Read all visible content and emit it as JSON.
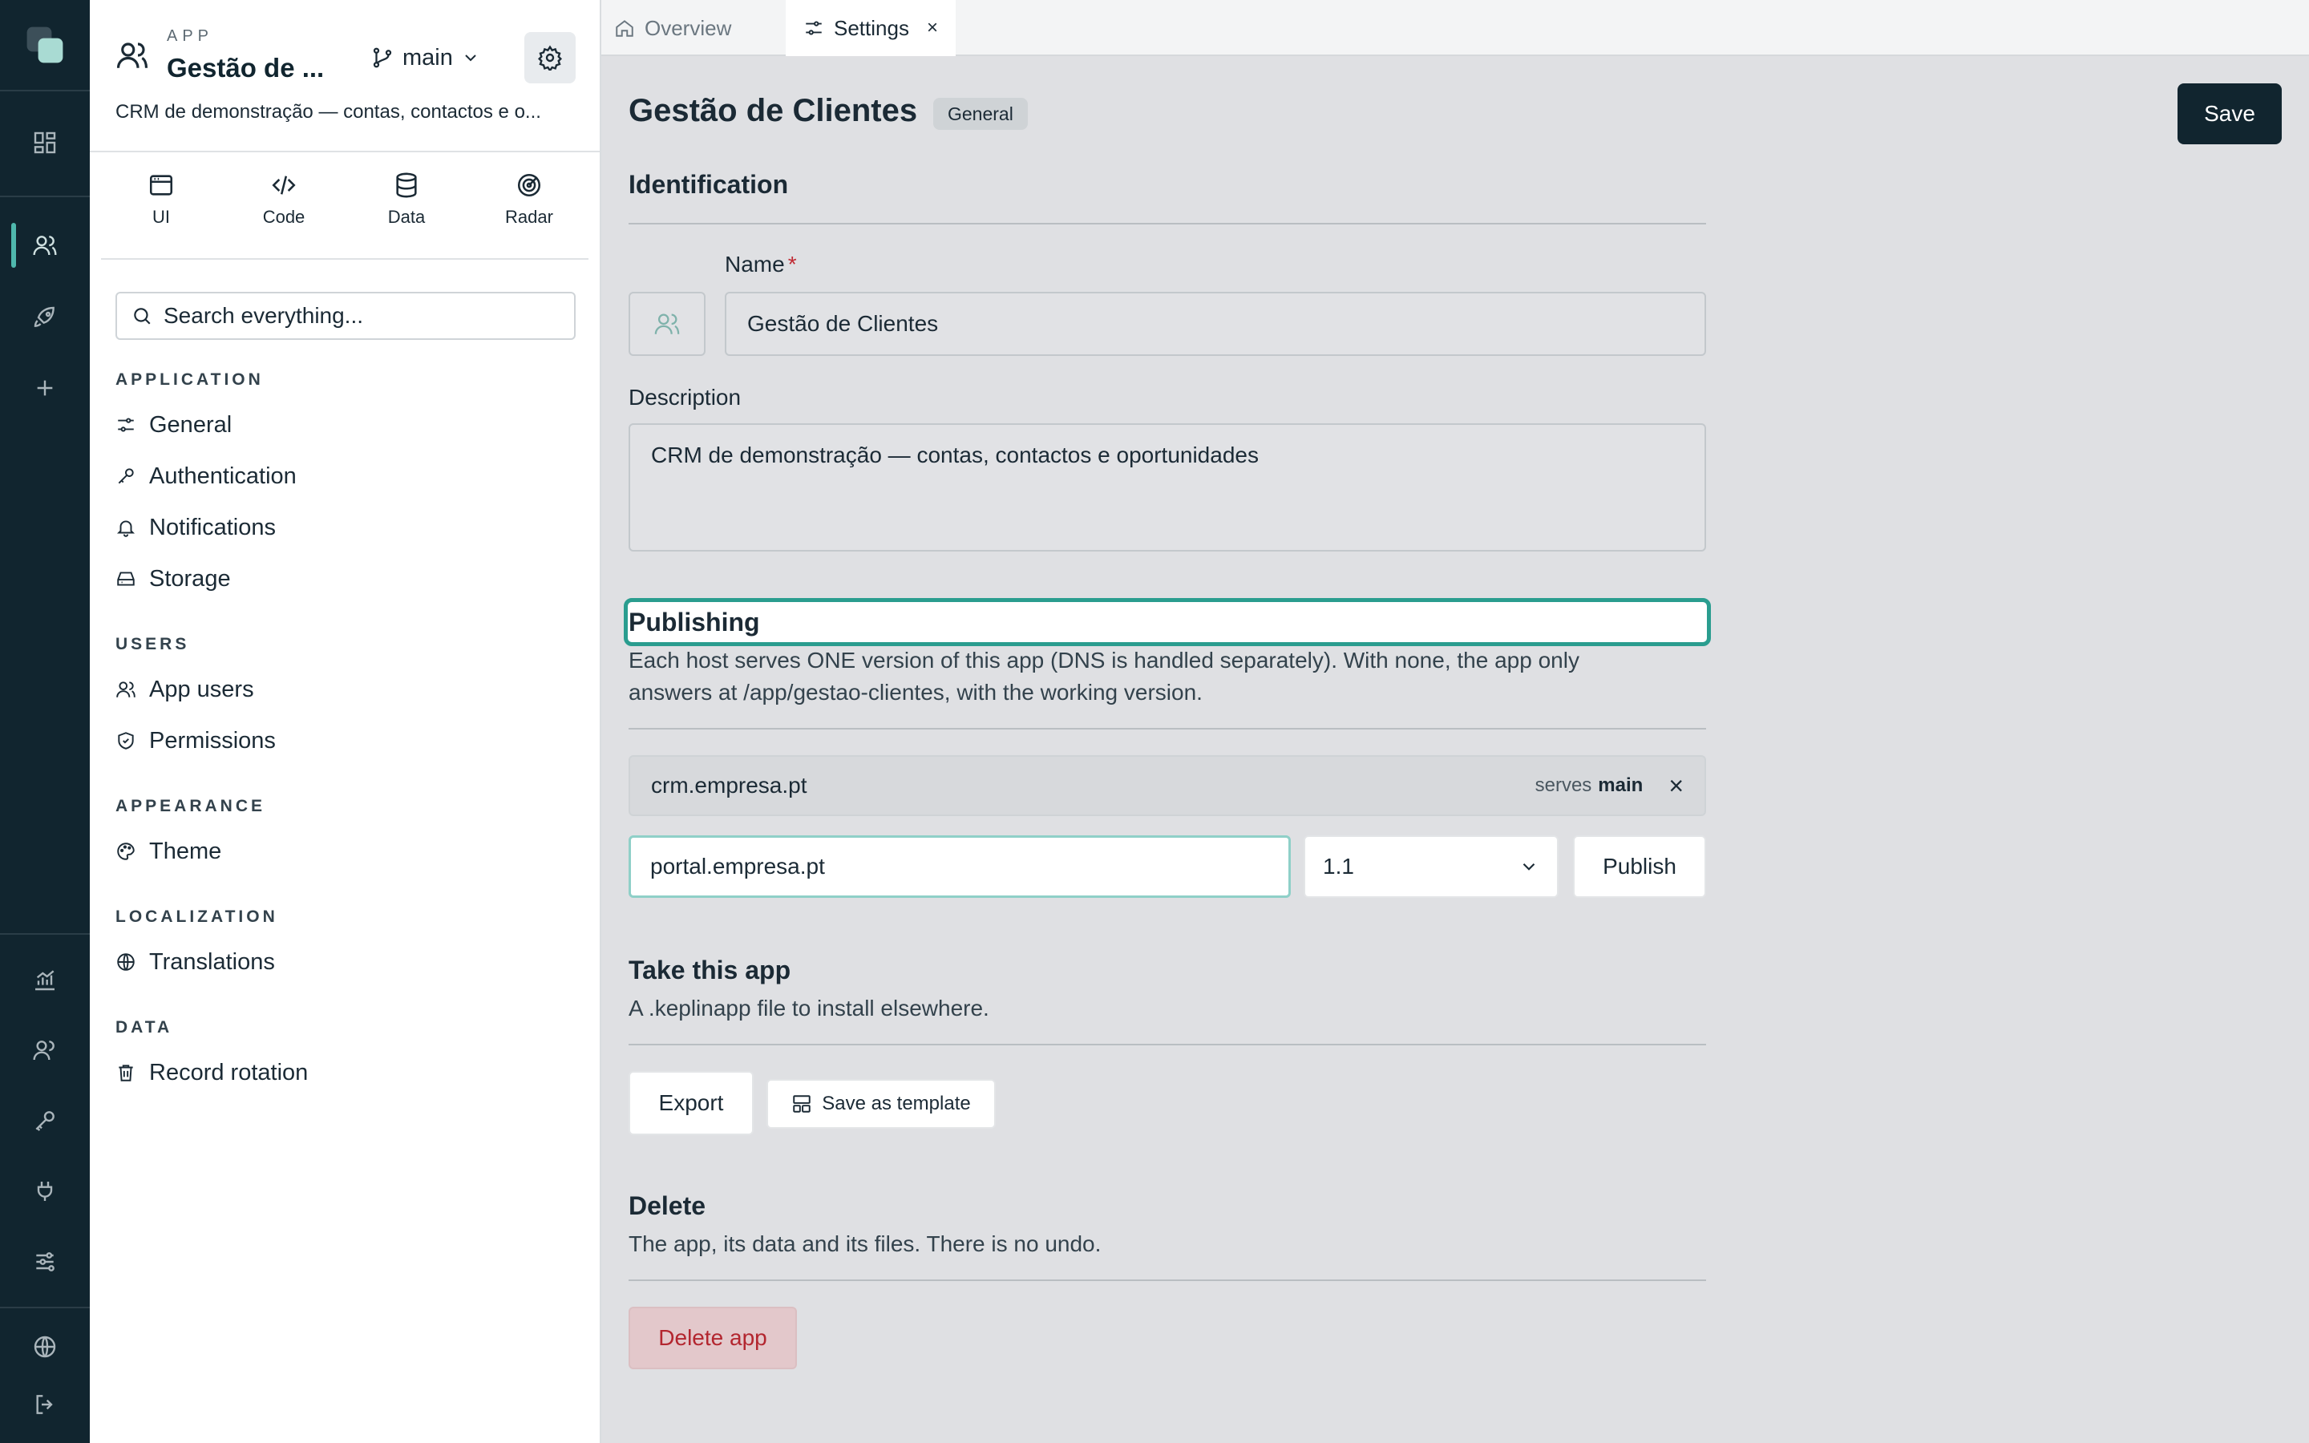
{
  "app": {
    "label": "APP",
    "title": "Gestão de ...",
    "branch": "main",
    "description": "CRM de demonstração — contas, contactos e o..."
  },
  "rail": {
    "icons": [
      "logo-icon",
      "dashboard-icon",
      "users-icon",
      "rocket-icon",
      "plus-icon",
      "chart-icon",
      "people-icon",
      "key-icon",
      "plug-icon",
      "sliders-icon",
      "globe-icon",
      "logout-icon"
    ]
  },
  "tools": [
    {
      "label": "UI",
      "icon": "browser-window-icon"
    },
    {
      "label": "Code",
      "icon": "code-icon"
    },
    {
      "label": "Data",
      "icon": "database-icon"
    },
    {
      "label": "Radar",
      "icon": "radar-icon"
    }
  ],
  "search": {
    "placeholder": "Search everything..."
  },
  "nav": {
    "application": {
      "title": "APPLICATION",
      "items": [
        {
          "label": "General",
          "icon": "sliders-small-icon"
        },
        {
          "label": "Authentication",
          "icon": "key-icon"
        },
        {
          "label": "Notifications",
          "icon": "bell-icon"
        },
        {
          "label": "Storage",
          "icon": "hard-drive-icon"
        }
      ]
    },
    "users": {
      "title": "USERS",
      "items": [
        {
          "label": "App users",
          "icon": "users-icon"
        },
        {
          "label": "Permissions",
          "icon": "shield-check-icon"
        }
      ]
    },
    "appearance": {
      "title": "APPEARANCE",
      "items": [
        {
          "label": "Theme",
          "icon": "palette-icon"
        }
      ]
    },
    "localization": {
      "title": "LOCALIZATION",
      "items": [
        {
          "label": "Translations",
          "icon": "globe-icon"
        }
      ]
    },
    "data": {
      "title": "DATA",
      "items": [
        {
          "label": "Record rotation",
          "icon": "trash-icon"
        }
      ]
    }
  },
  "tabs": [
    {
      "label": "Overview",
      "icon": "home-icon"
    },
    {
      "label": "Settings",
      "icon": "sliders-small-icon",
      "close": "×"
    }
  ],
  "page": {
    "title": "Gestão de Clientes",
    "badge": "General",
    "save": "Save"
  },
  "identification": {
    "heading": "Identification",
    "name_label": "Name",
    "required_mark": "*",
    "name_value": "Gestão de Clientes",
    "description_label": "Description",
    "description_value": "CRM de demonstração — contas, contactos e oportunidades"
  },
  "publishing": {
    "heading": "Publishing",
    "help_line1": "Each host serves ONE version of this app (DNS is handled separately). With none, the app only",
    "help_line2": "answers at /app/gestao-clientes, with the working version.",
    "host": "crm.empresa.pt",
    "serves_prefix": "serves",
    "serves_branch": "main",
    "remove": "×",
    "new_host_value": "portal.empresa.pt",
    "version": "1.1",
    "publish": "Publish"
  },
  "take": {
    "heading": "Take this app",
    "help": "A .keplinapp file to install elsewhere.",
    "export": "Export",
    "template": "Save as template"
  },
  "delete": {
    "heading": "Delete",
    "help": "The app, its data and its files. There is no undo.",
    "button": "Delete app"
  },
  "colors": {
    "rail": "#11252f",
    "accent": "#2a9d8f",
    "danger_bg": "#e3c8cb",
    "danger_text": "#b3262f"
  }
}
